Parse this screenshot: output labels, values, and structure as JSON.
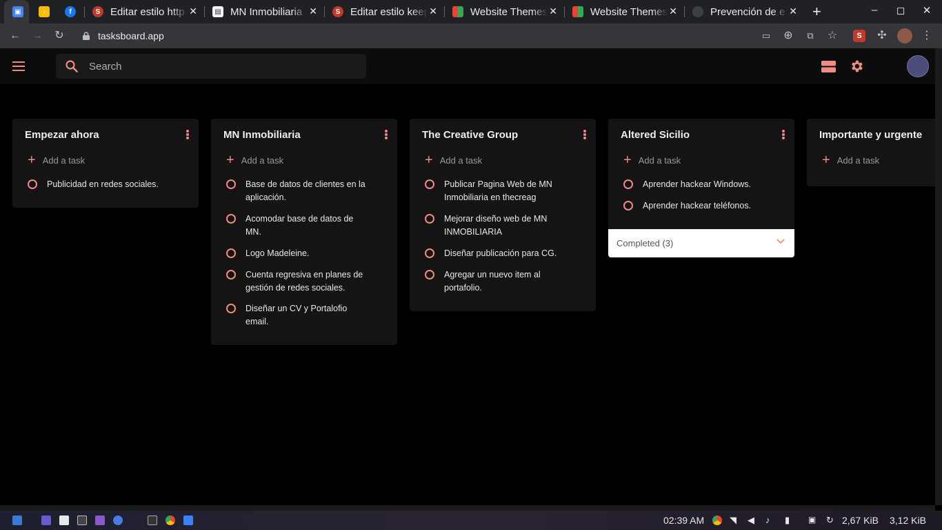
{
  "browser": {
    "tabs": [
      {
        "title": "",
        "active": true
      },
      {
        "title": ""
      },
      {
        "title": ""
      },
      {
        "title": "Editar estilo http"
      },
      {
        "title": "MN Inmobiliaria"
      },
      {
        "title": "Editar estilo keep"
      },
      {
        "title": "Website Themes"
      },
      {
        "title": "Website Themes"
      },
      {
        "title": "Prevención de e"
      }
    ],
    "url": "tasksboard.app"
  },
  "app": {
    "search_placeholder": "Search",
    "add_task_label": "Add a task",
    "lists": [
      {
        "title": "Empezar ahora",
        "tasks": [
          "Publicidad en redes sociales."
        ]
      },
      {
        "title": "MN Inmobiliaria",
        "tasks": [
          "Base de datos de clientes en la aplicación.",
          "Acomodar base de datos de MN.",
          "Logo Madeleine.",
          "Cuenta regresiva en planes de gestión de redes sociales.",
          "Diseñar un CV y Portalofio email."
        ]
      },
      {
        "title": "The Creative Group",
        "tasks": [
          "Publicar Pagina Web de MN Inmobiliaria en thecreag",
          "Mejorar diseño web de MN INMOBILIARIA",
          "Diseñar publicación para CG.",
          "Agregar un nuevo item al portafolio."
        ]
      },
      {
        "title": "Altered Sicilio",
        "tasks": [
          "Aprender hackear Windows.",
          "Aprender hackear teléfonos."
        ],
        "completed_label": "Completed (3)"
      },
      {
        "title": "Importante y urgente",
        "tasks": []
      }
    ]
  },
  "taskbar": {
    "time": "02:39 AM",
    "net_down": "2,67 KiB",
    "net_up": "3,12 KiB"
  },
  "colors": {
    "accent": "#f28b82",
    "list_bg": "#141414",
    "page_bg": "#000000"
  }
}
